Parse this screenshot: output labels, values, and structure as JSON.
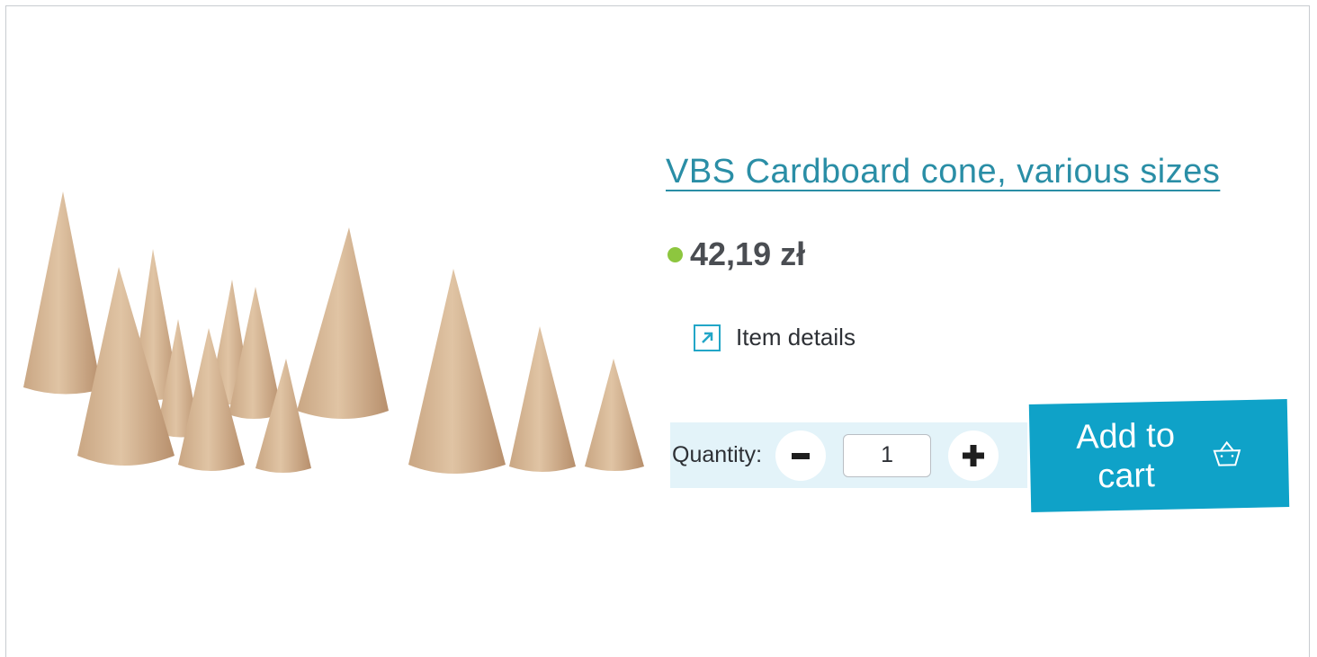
{
  "product": {
    "title": "VBS Cardboard cone, various sizes",
    "price": "42,19 zł",
    "stock_color": "#8dc63f",
    "image_icon": "paper-cones-photo"
  },
  "details": {
    "label": "Item details",
    "icon": "external-arrow-icon"
  },
  "quantity": {
    "label": "Quantity:",
    "value": "1",
    "decrease_icon": "minus-icon",
    "increase_icon": "plus-icon"
  },
  "cart": {
    "label": "Add to cart",
    "icon": "basket-icon",
    "color": "#0fa2c8"
  },
  "colors": {
    "accent": "#22a6c7",
    "title": "#2a8ea6",
    "qty_bg": "#e3f3f9"
  }
}
